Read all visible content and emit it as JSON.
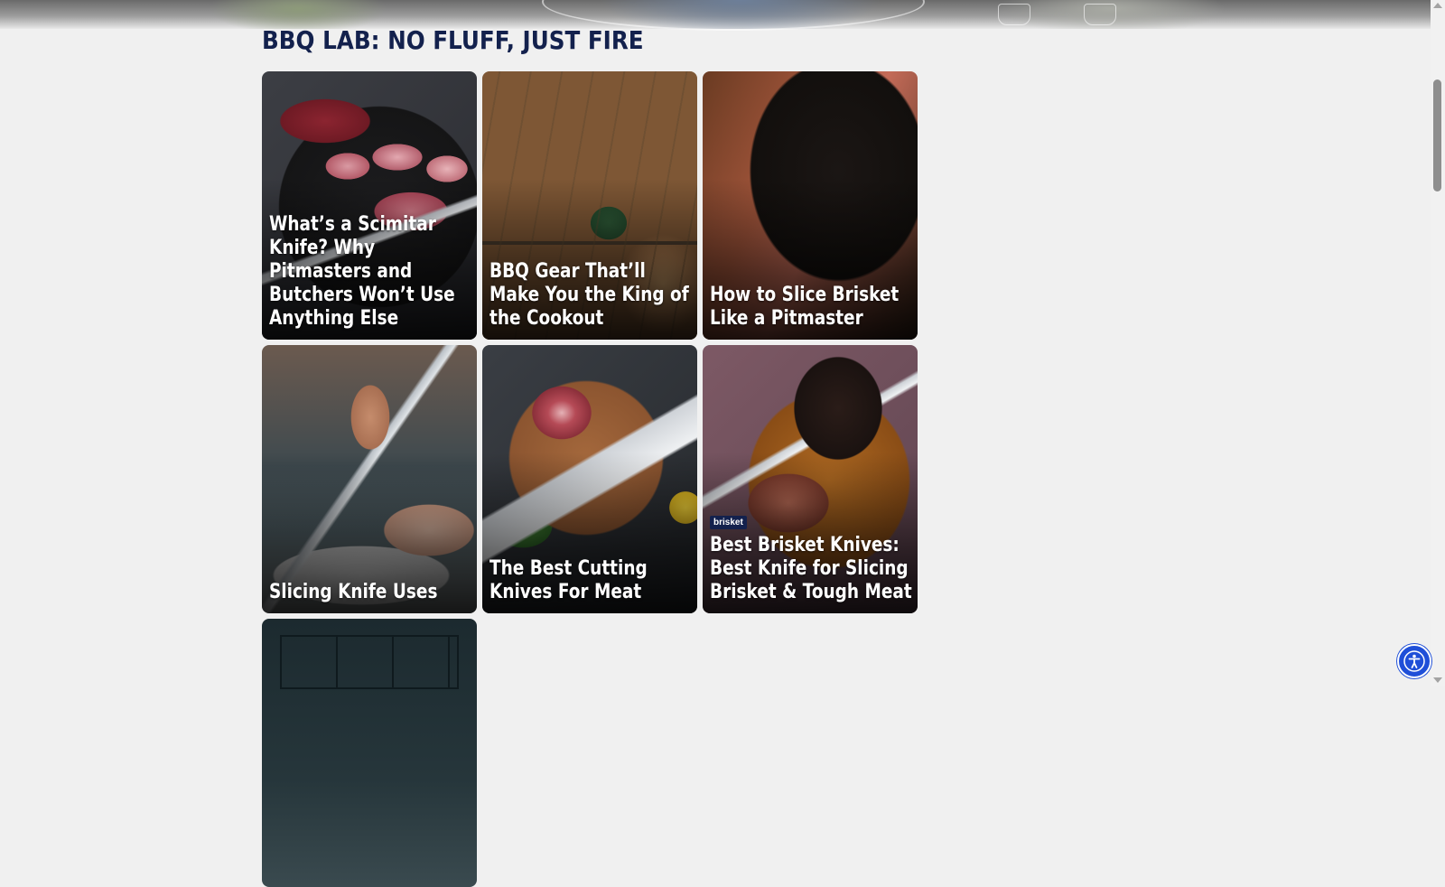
{
  "section": {
    "title": "BBQ LAB: NO FLUFF, JUST FIRE"
  },
  "cards": [
    {
      "title": "What’s a Scimitar Knife? Why Pitmasters and Butchers Won’t Use Anything Else",
      "tag": ""
    },
    {
      "title": "BBQ Gear That’ll Make You the King of the Cookout",
      "tag": ""
    },
    {
      "title": "How to Slice Brisket Like a Pitmaster",
      "tag": ""
    },
    {
      "title": "Slicing Knife Uses",
      "tag": ""
    },
    {
      "title": "The Best Cutting Knives For Meat",
      "tag": ""
    },
    {
      "title": "Best Brisket Knives: Best Knife for Slicing Brisket & Tough Meat",
      "tag": "brisket"
    },
    {
      "title": "",
      "tag": ""
    }
  ],
  "icons": {
    "accessibility": "accessibility-icon"
  },
  "colors": {
    "heading": "#13214d",
    "tag_bg": "#13214d",
    "accessibility_button": "#1f4fd8"
  }
}
